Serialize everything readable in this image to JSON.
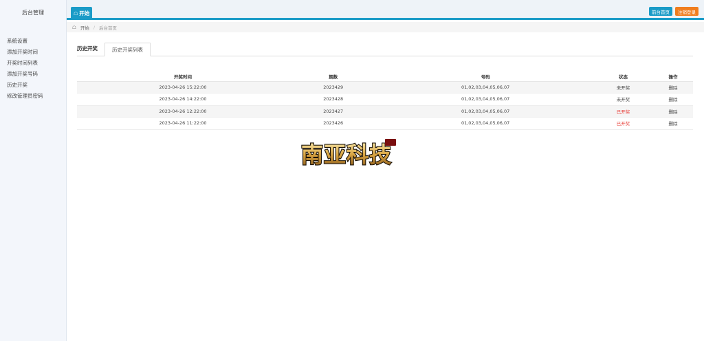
{
  "sidebar": {
    "title": "后台管理",
    "items": [
      {
        "label": "系统设置"
      },
      {
        "label": "添加开奖时间"
      },
      {
        "label": "开奖时间列表"
      },
      {
        "label": "添加开奖号码"
      },
      {
        "label": "历史开奖"
      },
      {
        "label": "修改管理员密码"
      }
    ]
  },
  "topbar": {
    "start_tab": "开始",
    "home_button": "前台首页",
    "logout_button": "注销登录"
  },
  "breadcrumb": {
    "home": "开始",
    "current": "后台首页"
  },
  "main": {
    "section_title": "历史开奖",
    "tab_label": "历史开奖列表",
    "table": {
      "headers": [
        "开奖时间",
        "期数",
        "号码",
        "状态",
        "操作"
      ],
      "rows": [
        {
          "time": "2023-04-26 15:22:00",
          "period": "2023429",
          "numbers": "01,02,03,04,05,06,07",
          "status": "未开奖",
          "action": "删除"
        },
        {
          "time": "2023-04-26 14:22:00",
          "period": "2023428",
          "numbers": "01,02,03,04,05,06,07",
          "status": "未开奖",
          "action": "删除"
        },
        {
          "time": "2023-04-26 12:22:00",
          "period": "2023427",
          "numbers": "01,02,03,04,05,06,07",
          "status": "已开奖",
          "action": "删除"
        },
        {
          "time": "2023-04-26 11:22:00",
          "period": "2023426",
          "numbers": "01,02,03,04,05,06,07",
          "status": "已开奖",
          "action": "删除"
        }
      ]
    }
  },
  "watermark": {
    "text": "南亚科技"
  },
  "colors": {
    "accent": "#1a9bc7",
    "logout": "#f07d1e",
    "status_done": "#e8403a"
  }
}
